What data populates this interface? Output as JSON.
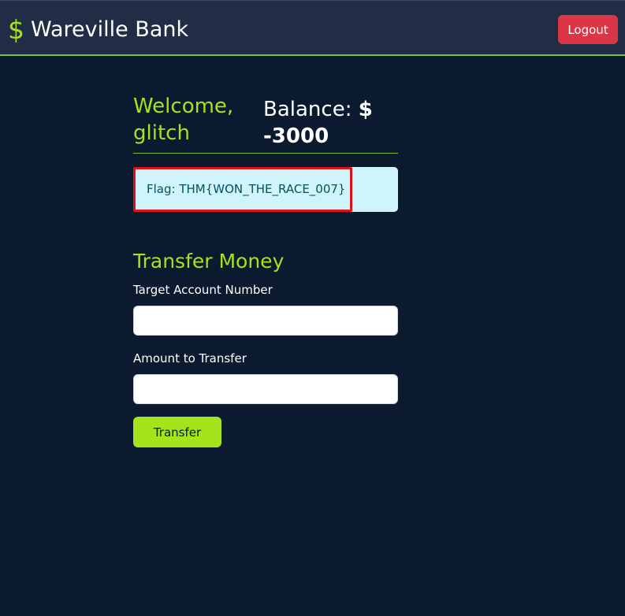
{
  "navbar": {
    "brand_icon": "$",
    "brand_name": "Wareville Bank",
    "logout_label": "Logout"
  },
  "account": {
    "welcome": "Welcome, glitch",
    "balance_label": "Balance:",
    "balance_value": "$ -3000"
  },
  "flag": {
    "text": "Flag: THM{WON_THE_RACE_007}"
  },
  "transfer": {
    "title": "Transfer Money",
    "target_label": "Target Account Number",
    "target_value": "",
    "amount_label": "Amount to Transfer",
    "amount_value": "",
    "submit_label": "Transfer"
  },
  "colors": {
    "background": "#0c1a30",
    "navbar": "#212c45",
    "accent": "#a4e41d",
    "danger": "#dc3545",
    "alert_bg": "#cff4fc",
    "highlight": "#e01018"
  }
}
